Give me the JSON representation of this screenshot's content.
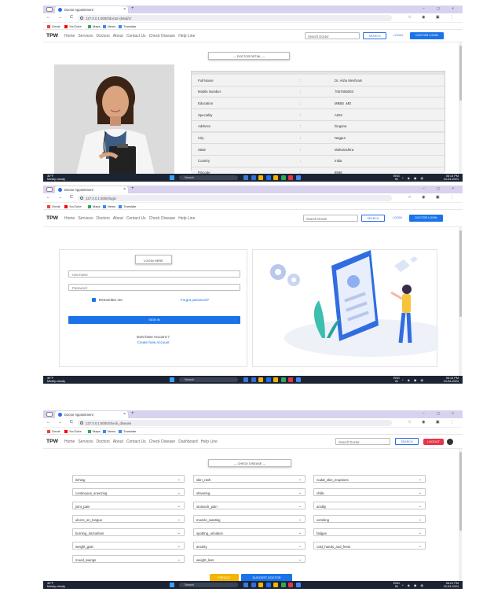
{
  "browser": {
    "tab_title": "Doctor Appointment",
    "new_tab_symbol": "+",
    "tab_close_symbol": "×",
    "window_controls": "– ▢ ×",
    "nav_buttons": "← → C",
    "toolbar_icons": "☆ ◉ ▣ ⋮",
    "bookmarks": [
      {
        "label": "Gmail",
        "color": "#ea4335"
      },
      {
        "label": "YouTube",
        "color": "#ff0000"
      },
      {
        "label": "Maps",
        "color": "#34a853"
      },
      {
        "label": "News",
        "color": "#4285f4"
      },
      {
        "label": "Translate",
        "color": "#4285f4"
      }
    ]
  },
  "site": {
    "brand": "TPW",
    "menu": [
      "Home",
      "Services",
      "Doctors",
      "About",
      "Contact Us",
      "Check Disease",
      "Help Line"
    ],
    "menu_logged_in": [
      "Home",
      "Services",
      "Doctors",
      "About",
      "Contact Us",
      "Check Disease",
      "Dashboard",
      "Help Line"
    ],
    "search_placeholder": "Search Doctor",
    "search_button": "SEARCH",
    "login_link": "LOGIN",
    "doctor_login_button": "DOCTOR LOGIN",
    "logout_button": "LOGOUT"
  },
  "taskbar": {
    "weather_temp": "30°F",
    "weather_desc": "Mostly cloudy",
    "search_label": "Search",
    "lang_1": "ENG",
    "lang_2": "IN",
    "tray_icons": "^ ◈ ◉ ◍",
    "app_colors": [
      "#3a7bd5",
      "#2f6de1",
      "#f5b400",
      "#1a73e8",
      "#f4b400",
      "#34a853",
      "#e8334a",
      "#4285f4"
    ]
  },
  "screen1": {
    "url": "127.0.0.1:8000/doctor-detail/1/",
    "section_title": "--- DOCTOR DETAIL ---",
    "rows": [
      {
        "label": "Full Name",
        "sep": ":",
        "value": "Dr. Ashu Meshram"
      },
      {
        "label": "Mobile Number",
        "sep": ":",
        "value": "7057555003"
      },
      {
        "label": "Education",
        "sep": ":",
        "value": "MBBS ,MD"
      },
      {
        "label": "Speciality",
        "sep": ":",
        "value": "AIDS"
      },
      {
        "label": "Address",
        "sep": ":",
        "value": "hingana"
      },
      {
        "label": "City",
        "sep": ":",
        "value": "Nagpur"
      },
      {
        "label": "State",
        "sep": ":",
        "value": "Maharashtra"
      },
      {
        "label": "Country",
        "sep": ":",
        "value": "India"
      },
      {
        "label": "Pincode",
        "sep": ":",
        "value": "8595"
      }
    ],
    "clock_time": "06:14 PM",
    "clock_date": "13-04-2024"
  },
  "screen2": {
    "url": "127.0.0.1:8000/login",
    "login_header": "LOGIN HERE",
    "username_placeholder": "Username",
    "password_placeholder": "Password",
    "remember_me": "Remember me",
    "forgot_password": "Forgot password?",
    "signin_button": "SIGN IN",
    "no_account_text": "Dont have Account ?",
    "create_account_link": "Create New Account",
    "clock_time": "06:14 PM",
    "clock_date": "13-04-2024"
  },
  "screen3": {
    "url": "127.0.0.1:8000/check_disease",
    "section_title": "--- CHECK DISEASE ---",
    "symptoms": [
      "itching",
      "skin_rash",
      "nodal_skin_eruptions",
      "continuous_sneezing",
      "shivering",
      "chills",
      "joint_pain",
      "stomach_pain",
      "acidity",
      "ulcers_on_tongue",
      "muscle_wasting",
      "vomiting",
      "burning_micturition",
      "spotting_urination",
      "fatigue",
      "weight_gain",
      "anxiety",
      "cold_hands_and_feets",
      "mood_swings",
      "weight_loss"
    ],
    "predict_button": "PREDICT",
    "suggest_button": "SUGGEST DOCTOR",
    "clock_time": "06:21 PM",
    "clock_date": "13-04-2024"
  }
}
